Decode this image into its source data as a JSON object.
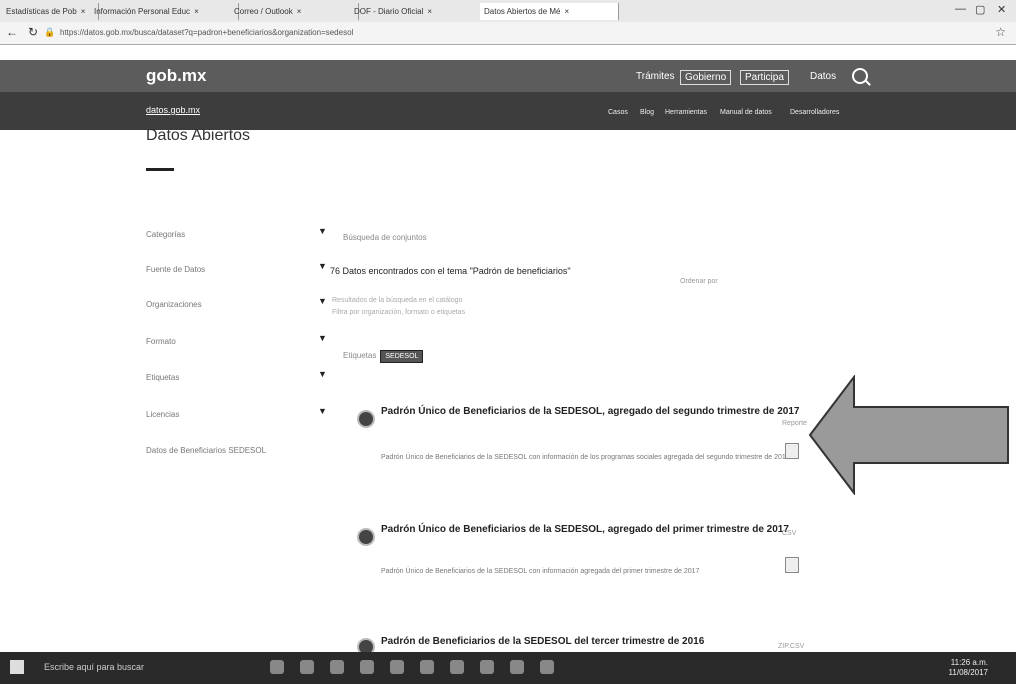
{
  "browser": {
    "tabs": [
      {
        "label": "Estadísticas de Pob"
      },
      {
        "label": "Información Personal Educ"
      },
      {
        "label": "Correo / Outlook"
      },
      {
        "label": "DOF - Diario Oficial"
      },
      {
        "label": "Datos Abiertos de Mé"
      }
    ],
    "url": "https://datos.gob.mx/busca/dataset?q=padron+beneficiarios&organization=sedesol",
    "minimize": "—",
    "maximize": "▢",
    "close": "✕"
  },
  "header": {
    "logo": "gob.mx",
    "links": [
      "Trámites",
      "Gobierno",
      "Participa",
      "Datos"
    ],
    "sub_brand": "datos.gob.mx",
    "sub_links": [
      "Casos",
      "Blog",
      "Herramientas",
      "Manual de datos",
      "Desarrolladores"
    ]
  },
  "page": {
    "title": "Datos Abiertos"
  },
  "sidebar": {
    "filters": [
      {
        "label": "Categorías"
      },
      {
        "label": "Fuente de Datos"
      },
      {
        "label": "Organizaciones"
      },
      {
        "label": "Formato"
      },
      {
        "label": "Etiquetas"
      },
      {
        "label": "Licencias"
      }
    ],
    "footer_link": "Datos de Beneficiarios SEDESOL"
  },
  "main": {
    "results_line": "Búsqueda de conjuntos",
    "filter_title": "76 Datos encontrados con el tema \"Padrón de beneficiarios\"",
    "sort_label": "Ordenar por",
    "desc_line1": "Resultados de la búsqueda en el catálogo",
    "desc_line2": "Filtra por organización, formato o etiquetas",
    "tags_label": "Etiquetas",
    "tag": "SEDESOL",
    "datasets": [
      {
        "title": "Padrón Único de Beneficiarios de la SEDESOL, agregado del segundo trimestre de 2017",
        "desc": "Padrón Único de Beneficiarios de la SEDESOL con información de los programas sociales agregada del segundo trimestre de 2017",
        "format": "Reporte"
      },
      {
        "title": "Padrón Único de Beneficiarios de la SEDESOL, agregado del primer trimestre de 2017",
        "desc": "Padrón Único de Beneficiarios de la SEDESOL con información agregada del primer trimestre de 2017",
        "format": "CSV"
      },
      {
        "title": "Padrón de Beneficiarios de la SEDESOL del tercer trimestre de 2016",
        "desc": "",
        "format": "ZIP.CSV"
      }
    ]
  },
  "taskbar": {
    "search_placeholder": "Escribe aquí para buscar",
    "time": "11:26 a.m.",
    "date": "11/08/2017"
  },
  "colors": {
    "top_nav": "#5c5c5c",
    "sub_nav": "#3d3d3d",
    "arrow_fill": "#9a9a9a",
    "taskbar": "#2a2a2a"
  }
}
